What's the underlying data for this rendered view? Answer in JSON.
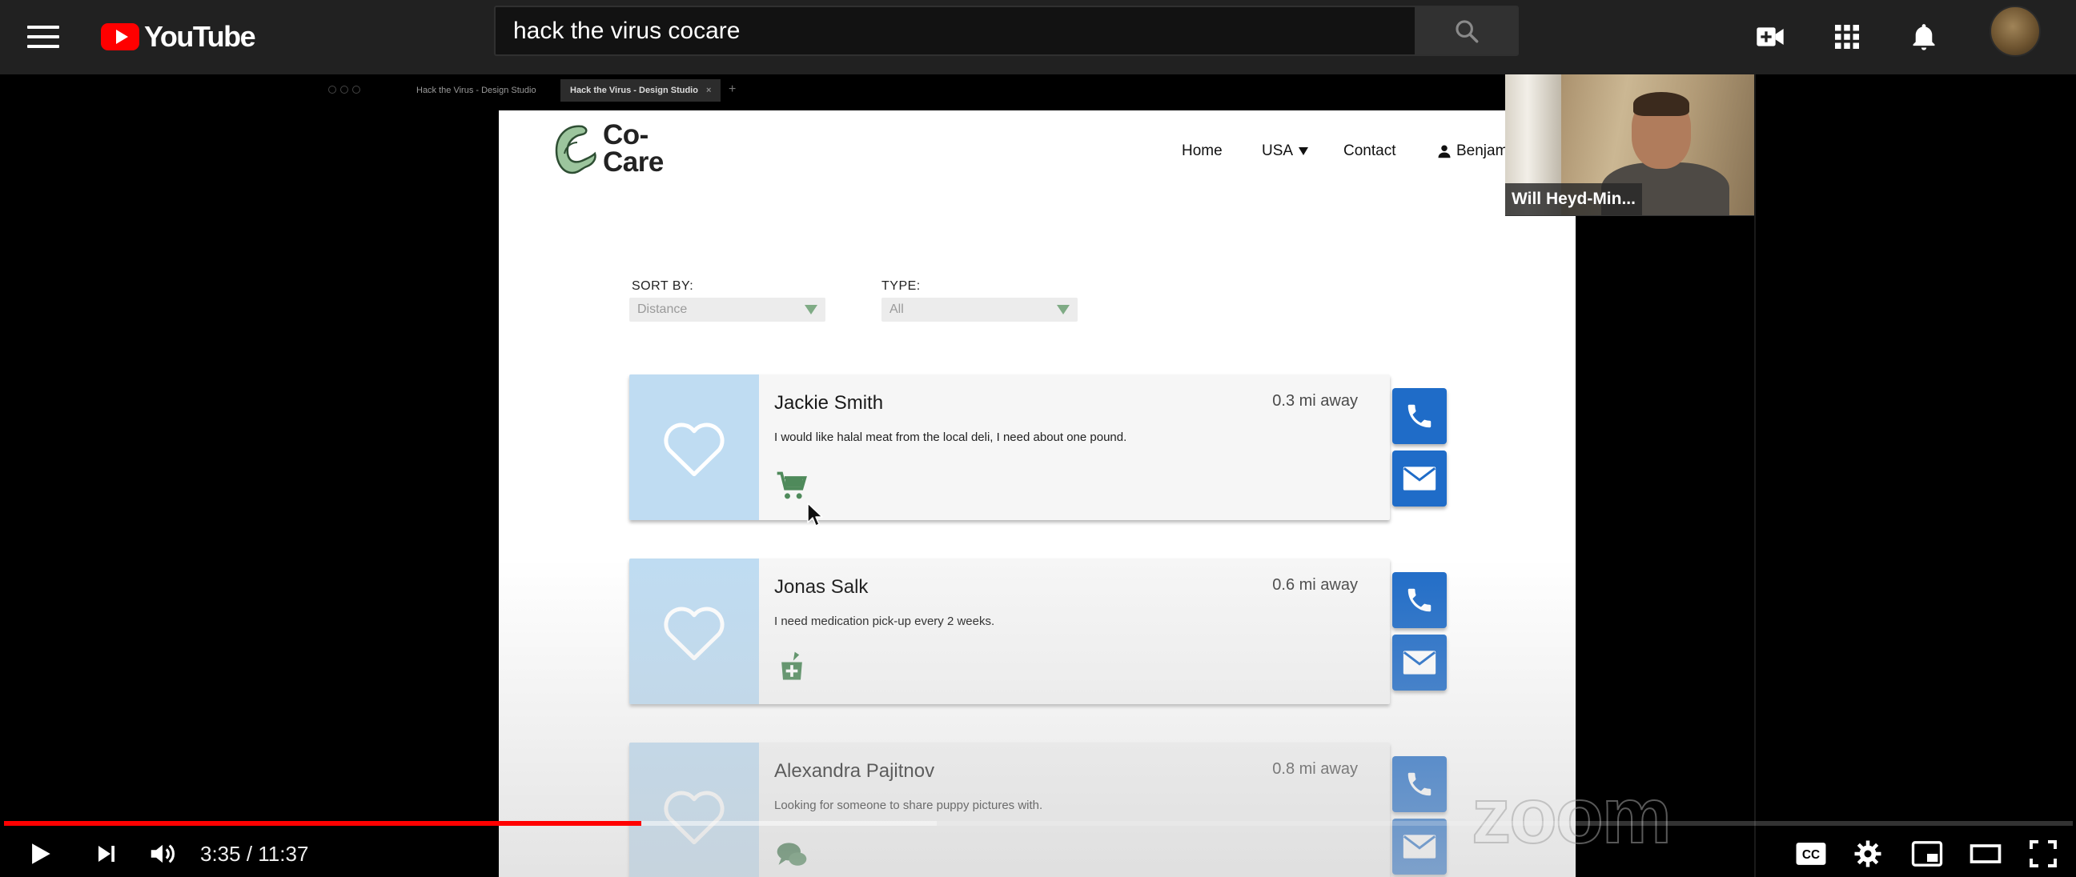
{
  "youtube": {
    "logo_text": "YouTube",
    "search_value": "hack the virus cocare",
    "icons": [
      "menu-icon",
      "search-icon",
      "create-video-icon",
      "apps-icon",
      "notifications-icon"
    ]
  },
  "browser_tabs": {
    "tab1": "Hack the Virus - Design Studio",
    "tab2": "Hack the Virus - Design Studio",
    "tab2_close": "×",
    "new_tab": "+"
  },
  "site": {
    "logo_line1": "Co-",
    "logo_line2": "Care",
    "nav": {
      "home": "Home",
      "country": "USA",
      "contact": "Contact",
      "user": "Benjam"
    },
    "sort_label": "SORT BY:",
    "sort_value": "Distance",
    "type_label": "TYPE:",
    "type_value": "All",
    "cards": [
      {
        "name": "Jackie Smith",
        "distance": "0.3 mi away",
        "description": "I would like halal meat from the local deli, I need about one pound.",
        "type_icon": "shopping-cart-icon"
      },
      {
        "name": "Jonas Salk",
        "distance": "0.6 mi away",
        "description": "I need medication pick-up every 2 weeks.",
        "type_icon": "pharmacy-icon"
      },
      {
        "name": "Alexandra Pajitnov",
        "distance": "0.8 mi away",
        "description": "Looking for someone to share puppy pictures with.",
        "type_icon": "chat-icon"
      }
    ]
  },
  "zoom": {
    "participant_name": "Will Heyd-Min...",
    "watermark": "zoom"
  },
  "player": {
    "current_time": "3:35",
    "separator": " / ",
    "duration": "11:37",
    "played_fraction": 0.308,
    "buffered_fraction": 0.451,
    "colors": {
      "played": "#ff0000",
      "accent_blue": "#1f6cc8",
      "heart_panel": "#bfdcf2",
      "icon_green": "#4f8a5b"
    }
  }
}
